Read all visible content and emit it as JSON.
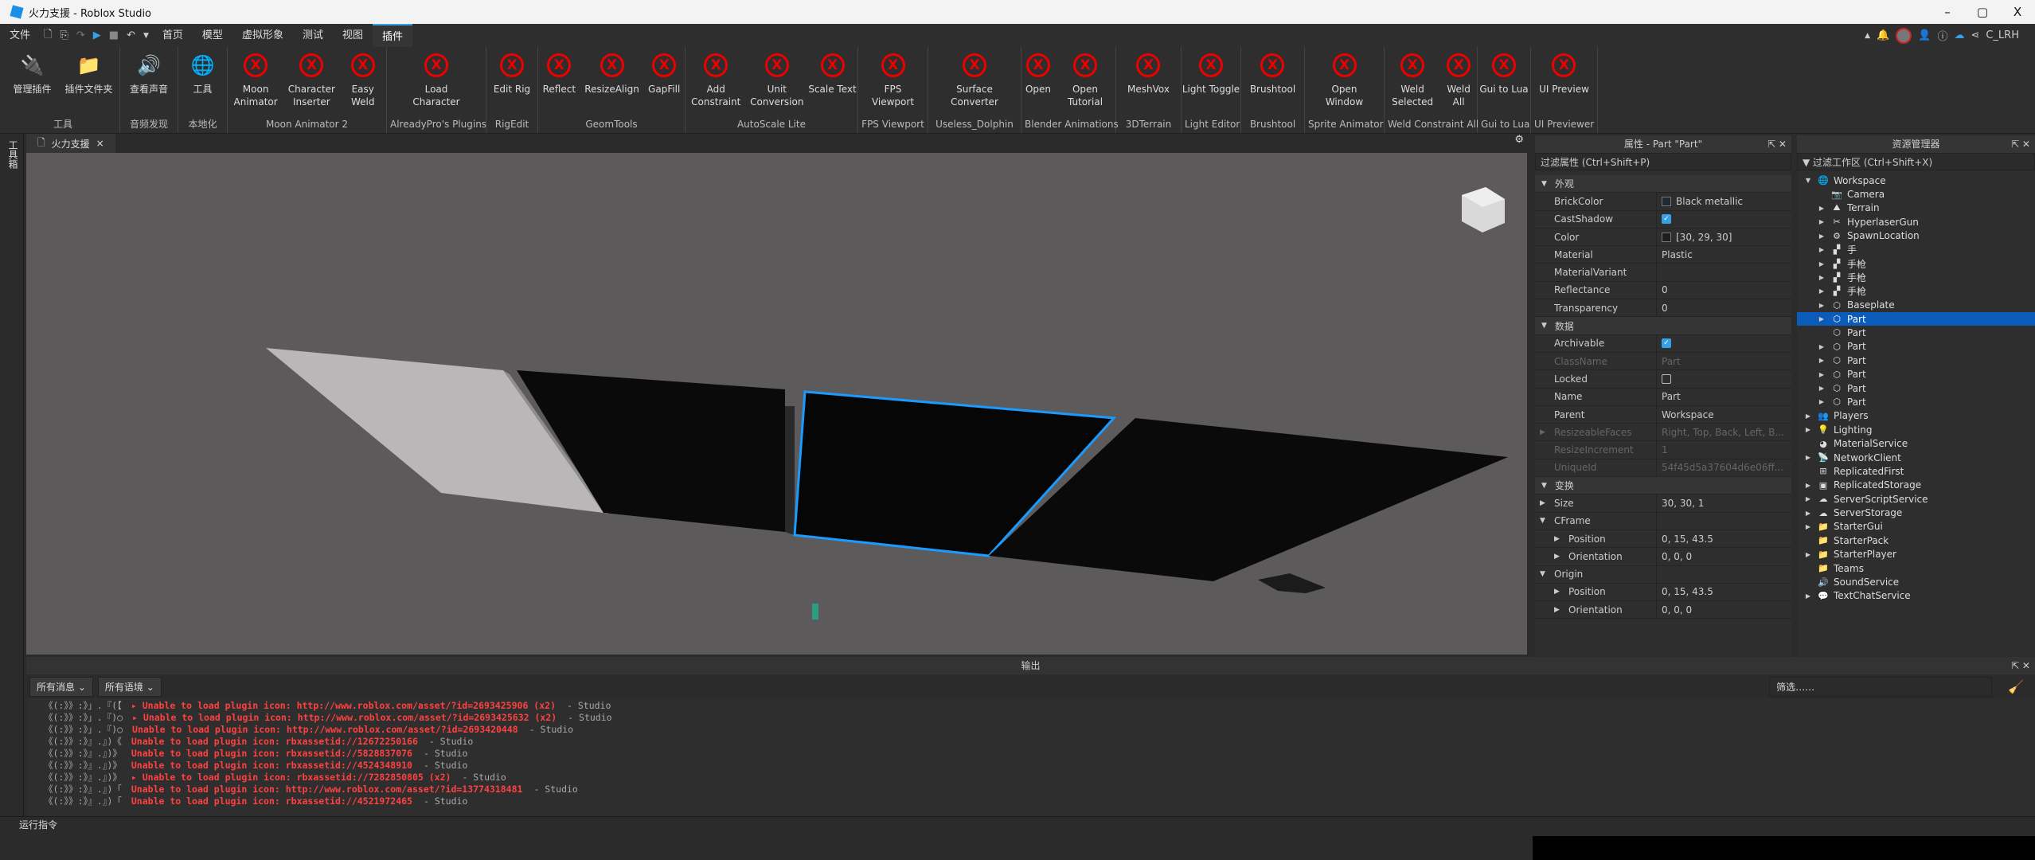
{
  "window": {
    "title": "火力支援 - Roblox Studio",
    "minimize": "–",
    "maximize": "▢",
    "close": "X"
  },
  "menu": {
    "file": "文件",
    "tabs": [
      "首页",
      "模型",
      "虚拟形象",
      "测试",
      "视图",
      "插件"
    ],
    "active_tab": "插件",
    "username": "C_LRH"
  },
  "ribbon": {
    "groups": [
      {
        "label": "工具",
        "buttons": [
          {
            "label": "管理插件",
            "icon": "plug-gear-icon"
          },
          {
            "label": "插件文件夹",
            "icon": "folder-plug-icon"
          }
        ],
        "w": 143
      },
      {
        "label": "音频发现",
        "buttons": [
          {
            "label": "查看声音",
            "icon": "speaker-icon"
          }
        ],
        "w": 73
      },
      {
        "label": "本地化",
        "buttons": [
          {
            "label": "工具",
            "icon": "globe-tool-icon"
          }
        ],
        "w": 62
      },
      {
        "label": "Moon Animator 2",
        "buttons": [
          {
            "label": "Moon Animator"
          },
          {
            "label": "Character Inserter"
          },
          {
            "label": "Easy Weld"
          }
        ],
        "w": 200
      },
      {
        "label": "AlreadyPro's Plugins",
        "buttons": [
          {
            "label": "Load Character"
          }
        ],
        "w": 125
      },
      {
        "label": "RigEdit",
        "buttons": [
          {
            "label": "Edit Rig"
          }
        ],
        "w": 65
      },
      {
        "label": "GeomTools",
        "buttons": [
          {
            "label": "Reflect"
          },
          {
            "label": "ResizeAlign"
          },
          {
            "label": "GapFill"
          }
        ],
        "w": 185
      },
      {
        "label": "AutoScale Lite",
        "buttons": [
          {
            "label": "Add Constraint"
          },
          {
            "label": "Unit Conversion"
          },
          {
            "label": "Scale Text"
          }
        ],
        "w": 217
      },
      {
        "label": "FPS Viewport",
        "buttons": [
          {
            "label": "FPS Viewport"
          }
        ],
        "w": 88
      },
      {
        "label": "Useless_Dolphin",
        "buttons": [
          {
            "label": "Surface Converter"
          }
        ],
        "w": 117
      },
      {
        "label": "Blender Animations",
        "buttons": [
          {
            "label": "Open"
          },
          {
            "label": "Open Tutorial"
          }
        ],
        "w": 119
      },
      {
        "label": "3DTerrain",
        "buttons": [
          {
            "label": "MeshVox"
          }
        ],
        "w": 82
      },
      {
        "label": "Light Editor",
        "buttons": [
          {
            "label": "Light Toggle"
          }
        ],
        "w": 75
      },
      {
        "label": "Brushtool",
        "buttons": [
          {
            "label": "Brushtool"
          }
        ],
        "w": 80
      },
      {
        "label": "Sprite Animator",
        "buttons": [
          {
            "label": "Open Window"
          }
        ],
        "w": 100
      },
      {
        "label": "Weld Constraint All",
        "buttons": [
          {
            "label": "Weld Selected"
          },
          {
            "label": "Weld All"
          }
        ],
        "w": 117
      },
      {
        "label": "Gui to Lua",
        "buttons": [
          {
            "label": "Gui to Lua"
          }
        ],
        "w": 67
      },
      {
        "label": "UI Previewer",
        "buttons": [
          {
            "label": "UI Preview"
          }
        ],
        "w": 84
      }
    ]
  },
  "left_toolbox": "工具箱",
  "document_tab": {
    "label": "火力支援",
    "close": "×"
  },
  "properties": {
    "title": "属性 - Part \"Part\"",
    "filter_placeholder": "过滤属性 (Ctrl+Shift+P)",
    "rows": [
      {
        "type": "section",
        "name": "外观"
      },
      {
        "name": "BrickColor",
        "value": "Black metallic",
        "swatch": "#1b2a35"
      },
      {
        "name": "CastShadow",
        "check": true
      },
      {
        "name": "Color",
        "value": "[30, 29, 30]",
        "swatch": "#1e1d1e"
      },
      {
        "name": "Material",
        "value": "Plastic"
      },
      {
        "name": "MaterialVariant",
        "value": ""
      },
      {
        "name": "Reflectance",
        "value": "0"
      },
      {
        "name": "Transparency",
        "value": "0"
      },
      {
        "type": "section",
        "name": "数据"
      },
      {
        "name": "Archivable",
        "check": true
      },
      {
        "name": "ClassName",
        "value": "Part",
        "dim": true
      },
      {
        "name": "Locked",
        "check": false
      },
      {
        "name": "Name",
        "value": "Part"
      },
      {
        "name": "Parent",
        "value": "Workspace"
      },
      {
        "name": "ResizeableFaces",
        "value": "Right, Top, Back, Left, B...",
        "dim": true,
        "expand": true
      },
      {
        "name": "ResizeIncrement",
        "value": "1",
        "dim": true
      },
      {
        "name": "UniqueId",
        "value": "54f45d5a37604d6e06ff...",
        "dim": true
      },
      {
        "type": "section",
        "name": "变换"
      },
      {
        "name": "Size",
        "value": "30, 30, 1",
        "expand": true
      },
      {
        "name": "CFrame",
        "value": "",
        "expanded": true
      },
      {
        "name": "Position",
        "value": "0, 15, 43.5",
        "sub": true
      },
      {
        "name": "Orientation",
        "value": "0, 0, 0",
        "sub": true
      },
      {
        "name": "Origin",
        "value": "",
        "expanded": true
      },
      {
        "name": "Position",
        "value": "0, 15, 43.5",
        "sub": true
      },
      {
        "name": "Orientation",
        "value": "0, 0, 0",
        "sub": true
      }
    ]
  },
  "explorer": {
    "title": "资源管理器",
    "filter_placeholder": "过滤工作区 (Ctrl+Shift+X)",
    "items": [
      {
        "label": "Workspace",
        "level": 0,
        "arrow": "down",
        "icon": "globe-icon",
        "glyph": "🌐"
      },
      {
        "label": "Camera",
        "level": 1,
        "arrow": "",
        "icon": "camera-icon",
        "glyph": "📷"
      },
      {
        "label": "Terrain",
        "level": 1,
        "arrow": "right",
        "icon": "terrain-icon",
        "glyph": "⛰"
      },
      {
        "label": "HyperlaserGun",
        "level": 1,
        "arrow": "right",
        "icon": "tool-icon",
        "glyph": "✂"
      },
      {
        "label": "SpawnLocation",
        "level": 1,
        "arrow": "right",
        "icon": "spawn-icon",
        "glyph": "⚙"
      },
      {
        "label": "手",
        "level": 1,
        "arrow": "right",
        "icon": "model-icon",
        "glyph": "▞"
      },
      {
        "label": "手枪",
        "level": 1,
        "arrow": "right",
        "icon": "model-icon",
        "glyph": "▞"
      },
      {
        "label": "手枪",
        "level": 1,
        "arrow": "right",
        "icon": "model-icon",
        "glyph": "▞"
      },
      {
        "label": "手枪",
        "level": 1,
        "arrow": "right",
        "icon": "model-icon",
        "glyph": "▞"
      },
      {
        "label": "Baseplate",
        "level": 1,
        "arrow": "right",
        "icon": "part-icon",
        "glyph": "⬡"
      },
      {
        "label": "Part",
        "level": 1,
        "arrow": "right",
        "icon": "part-icon",
        "glyph": "⬡",
        "selected": true
      },
      {
        "label": "Part",
        "level": 1,
        "arrow": "",
        "icon": "part-icon",
        "glyph": "⬡"
      },
      {
        "label": "Part",
        "level": 1,
        "arrow": "right",
        "icon": "part-icon",
        "glyph": "⬡"
      },
      {
        "label": "Part",
        "level": 1,
        "arrow": "right",
        "icon": "part-icon",
        "glyph": "⬡"
      },
      {
        "label": "Part",
        "level": 1,
        "arrow": "right",
        "icon": "part-icon",
        "glyph": "⬡"
      },
      {
        "label": "Part",
        "level": 1,
        "arrow": "right",
        "icon": "part-icon",
        "glyph": "⬡"
      },
      {
        "label": "Part",
        "level": 1,
        "arrow": "right",
        "icon": "part-icon",
        "glyph": "⬡"
      },
      {
        "label": "Players",
        "level": 0,
        "arrow": "right",
        "icon": "players-icon",
        "glyph": "👥"
      },
      {
        "label": "Lighting",
        "level": 0,
        "arrow": "right",
        "icon": "lightbulb-icon",
        "glyph": "💡"
      },
      {
        "label": "MaterialService",
        "level": 0,
        "arrow": "",
        "icon": "material-service-icon",
        "glyph": "◕"
      },
      {
        "label": "NetworkClient",
        "level": 0,
        "arrow": "right",
        "icon": "network-icon",
        "glyph": "📡"
      },
      {
        "label": "ReplicatedFirst",
        "level": 0,
        "arrow": "",
        "icon": "replicated-first-icon",
        "glyph": "⊞"
      },
      {
        "label": "ReplicatedStorage",
        "level": 0,
        "arrow": "right",
        "icon": "storage-icon",
        "glyph": "▣"
      },
      {
        "label": "ServerScriptService",
        "level": 0,
        "arrow": "right",
        "icon": "server-script-icon",
        "glyph": "☁"
      },
      {
        "label": "ServerStorage",
        "level": 0,
        "arrow": "right",
        "icon": "server-storage-icon",
        "glyph": "☁"
      },
      {
        "label": "StarterGui",
        "level": 0,
        "arrow": "right",
        "icon": "starter-gui-icon",
        "glyph": "📁"
      },
      {
        "label": "StarterPack",
        "level": 0,
        "arrow": "",
        "icon": "starter-pack-icon",
        "glyph": "📁"
      },
      {
        "label": "StarterPlayer",
        "level": 0,
        "arrow": "right",
        "icon": "starter-player-icon",
        "glyph": "📁"
      },
      {
        "label": "Teams",
        "level": 0,
        "arrow": "",
        "icon": "teams-icon",
        "glyph": "📁"
      },
      {
        "label": "SoundService",
        "level": 0,
        "arrow": "",
        "icon": "sound-icon",
        "glyph": "🔊"
      },
      {
        "label": "TextChatService",
        "level": 0,
        "arrow": "right",
        "icon": "chat-icon",
        "glyph": "💬"
      }
    ]
  },
  "output": {
    "title": "输出",
    "filter1": "所有消息",
    "filter2": "所有语境",
    "search_placeholder": "筛选……",
    "lines": [
      {
        "ts": "《(:》》:》」.『(【",
        "msg": "▸ Unable to load plugin icon: http://www.roblox.com/asset/?id=2693425906 (x2)",
        "src": "-  Studio"
      },
      {
        "ts": "《(:》》:》」.『)○",
        "msg": "▸ Unable to load plugin icon: http://www.roblox.com/asset/?id=2693425632 (x2)",
        "src": "-  Studio"
      },
      {
        "ts": "《(:》》:》」.『)○",
        "msg": "Unable to load plugin icon: http://www.roblox.com/asset/?id=2693420448",
        "src": "-  Studio"
      },
      {
        "ts": "《(:》》:》』.』)《",
        "msg": "Unable to load plugin icon: rbxassetid://12672250166",
        "src": "-  Studio"
      },
      {
        "ts": "《(:》》:》』.』)》",
        "msg": "Unable to load plugin icon: rbxassetid://5828837076",
        "src": "-  Studio"
      },
      {
        "ts": "《(:》》:》』.』)》",
        "msg": "Unable to load plugin icon: rbxassetid://4524348910",
        "src": "-  Studio"
      },
      {
        "ts": "《(:》》:》』.』)》",
        "msg": "▸ Unable to load plugin icon: rbxassetid://7282850805 (x2)",
        "src": "-  Studio"
      },
      {
        "ts": "《(:》》:》』.』)「",
        "msg": "Unable to load plugin icon: http://www.roblox.com/asset/?id=13774318481",
        "src": "-  Studio"
      },
      {
        "ts": "《(:》》:》』.』)「",
        "msg": "Unable to load plugin icon: rbxassetid://4521972465",
        "src": "-  Studio"
      }
    ]
  },
  "command_bar": {
    "placeholder": "运行指令"
  },
  "colors": {
    "accent": "#35a2e8",
    "selection": "#0b5bbb",
    "error": "#ff4141",
    "viewport": "#5d5a5c"
  }
}
